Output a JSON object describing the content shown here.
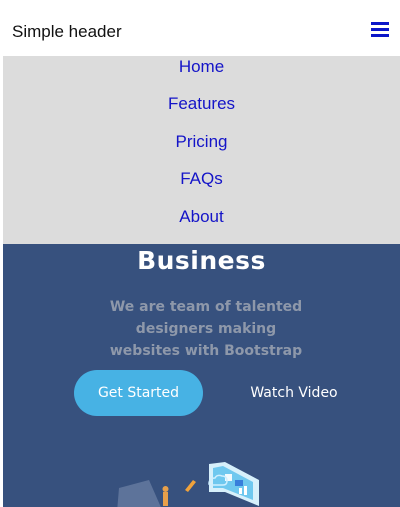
{
  "header": {
    "brand": "Simple header",
    "menu_icon": "hamburger-menu-icon"
  },
  "nav": {
    "items": [
      {
        "label": "Home"
      },
      {
        "label": "Features"
      },
      {
        "label": "Pricing"
      },
      {
        "label": "FAQs"
      },
      {
        "label": "About"
      }
    ]
  },
  "hero": {
    "title": "Business",
    "subtitle_lines": [
      "We are team of talented",
      "designers making",
      "websites with Bootstrap"
    ],
    "primary_button": "Get Started",
    "secondary_button": "Watch Video",
    "illustration_icon": "isometric-workspace-illustration"
  },
  "colors": {
    "header_bg": "#ffffff",
    "menu_icon": "#0b16c9",
    "nav_bg": "#dcdcdc",
    "nav_link": "#1414c8",
    "hero_bg": "#37517e",
    "hero_subtitle": "#8e98aa",
    "primary_button_bg": "#47b2e4"
  }
}
